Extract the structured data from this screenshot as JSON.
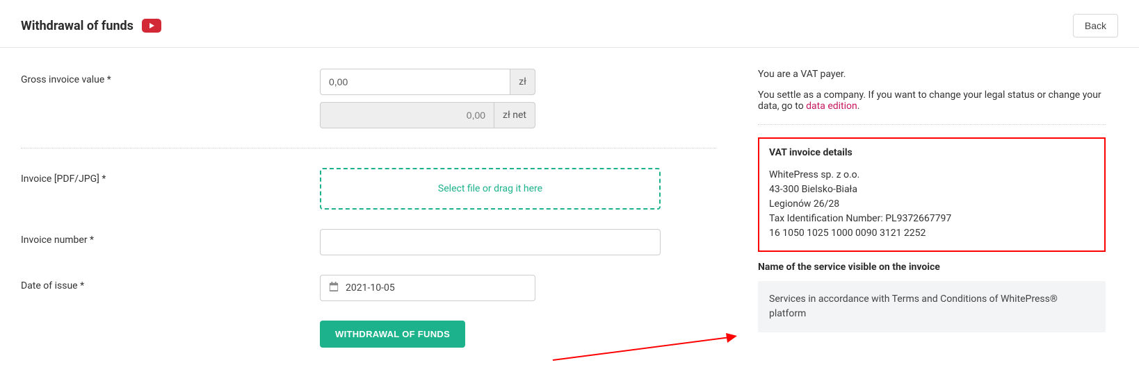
{
  "header": {
    "title": "Withdrawal of funds",
    "back_label": "Back"
  },
  "form": {
    "gross_invoice_label": "Gross invoice value  *",
    "gross_value": "0,00",
    "gross_suffix": "zł",
    "net_value": "0,00",
    "net_suffix": "zł net",
    "file_label": "Invoice [PDF/JPG] *",
    "file_drop_text": "Select file or drag it here",
    "invoice_number_label": "Invoice number *",
    "invoice_number_value": "",
    "date_label": "Date of issue *",
    "date_value": "2021-10-05",
    "submit_label": "WITHDRAWAL OF FUNDS"
  },
  "side": {
    "vat_payer_text": "You are a VAT payer.",
    "settle_text_prefix": "You settle as a company. If you want to change your legal status or change your data, go to ",
    "settle_link": "data edition",
    "settle_text_suffix": ".",
    "invoice_details_title": "VAT invoice details",
    "company_name": "WhitePress sp. z o.o.",
    "company_city": "43-300 Bielsko-Biała",
    "company_street": "Legionów 26/28",
    "tax_id": "Tax Identification Number: PL9372667797",
    "bank": "16 1050 1025 1000 0090 3121 2252",
    "service_name_label": "Name of the service visible on the invoice",
    "service_text": "Services in accordance with Terms and Conditions of WhitePress® platform"
  }
}
